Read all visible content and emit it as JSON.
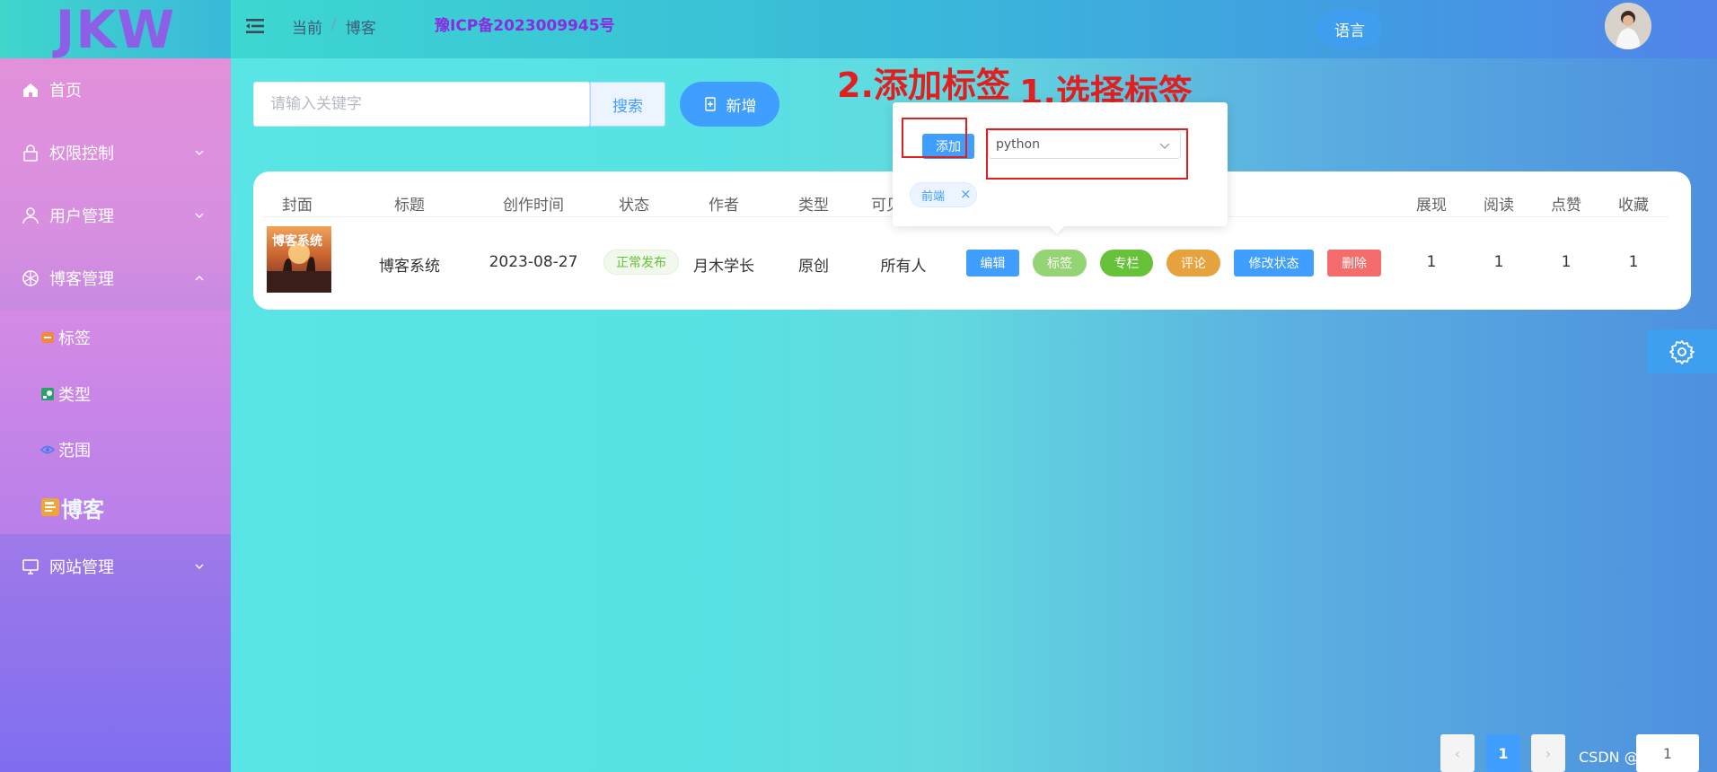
{
  "logo": {
    "text": "JKW"
  },
  "sidebar": {
    "items": [
      {
        "label": "首页"
      },
      {
        "label": "权限控制"
      },
      {
        "label": "用户管理"
      },
      {
        "label": "博客管理"
      },
      {
        "label": "网站管理"
      }
    ],
    "sub_items": [
      {
        "label": "标签"
      },
      {
        "label": "类型"
      },
      {
        "label": "范围"
      },
      {
        "label": "博客"
      }
    ]
  },
  "header": {
    "breadcrumb": [
      "当前",
      "博客"
    ],
    "icp": "豫ICP备2023009945号",
    "lang_label": "语言"
  },
  "search": {
    "placeholder": "请输入关键字",
    "button": "搜索",
    "add_button": "新增"
  },
  "annotations": {
    "step2": "2.添加标签",
    "step1": "1.选择标签"
  },
  "popover": {
    "add_label": "添加",
    "selected": "python",
    "chip": "前端",
    "chip_close": "×"
  },
  "table": {
    "headers": [
      "封面",
      "标题",
      "创作时间",
      "状态",
      "作者",
      "类型",
      "可见",
      "展现",
      "阅读",
      "点赞",
      "收藏"
    ],
    "row": {
      "cover_text": "博客系统",
      "title": "博客系统",
      "time": "2023-08-27",
      "status": "正常发布",
      "author": "月木学长",
      "type": "原创",
      "visibility": "所有人",
      "ops": [
        "编辑",
        "标签",
        "专栏",
        "评论",
        "修改状态",
        "删除"
      ],
      "show": "1",
      "read": "1",
      "like": "1",
      "fav": "1"
    }
  },
  "pagination": {
    "prev": "‹",
    "current": "1",
    "next": "›",
    "jump": "1"
  },
  "watermark": "CSDN @月木学长",
  "colors": {
    "primary": "#409eff",
    "success": "#67c23a",
    "warning": "#e6a23c",
    "danger": "#f56c6c",
    "annotation": "#e02020"
  }
}
